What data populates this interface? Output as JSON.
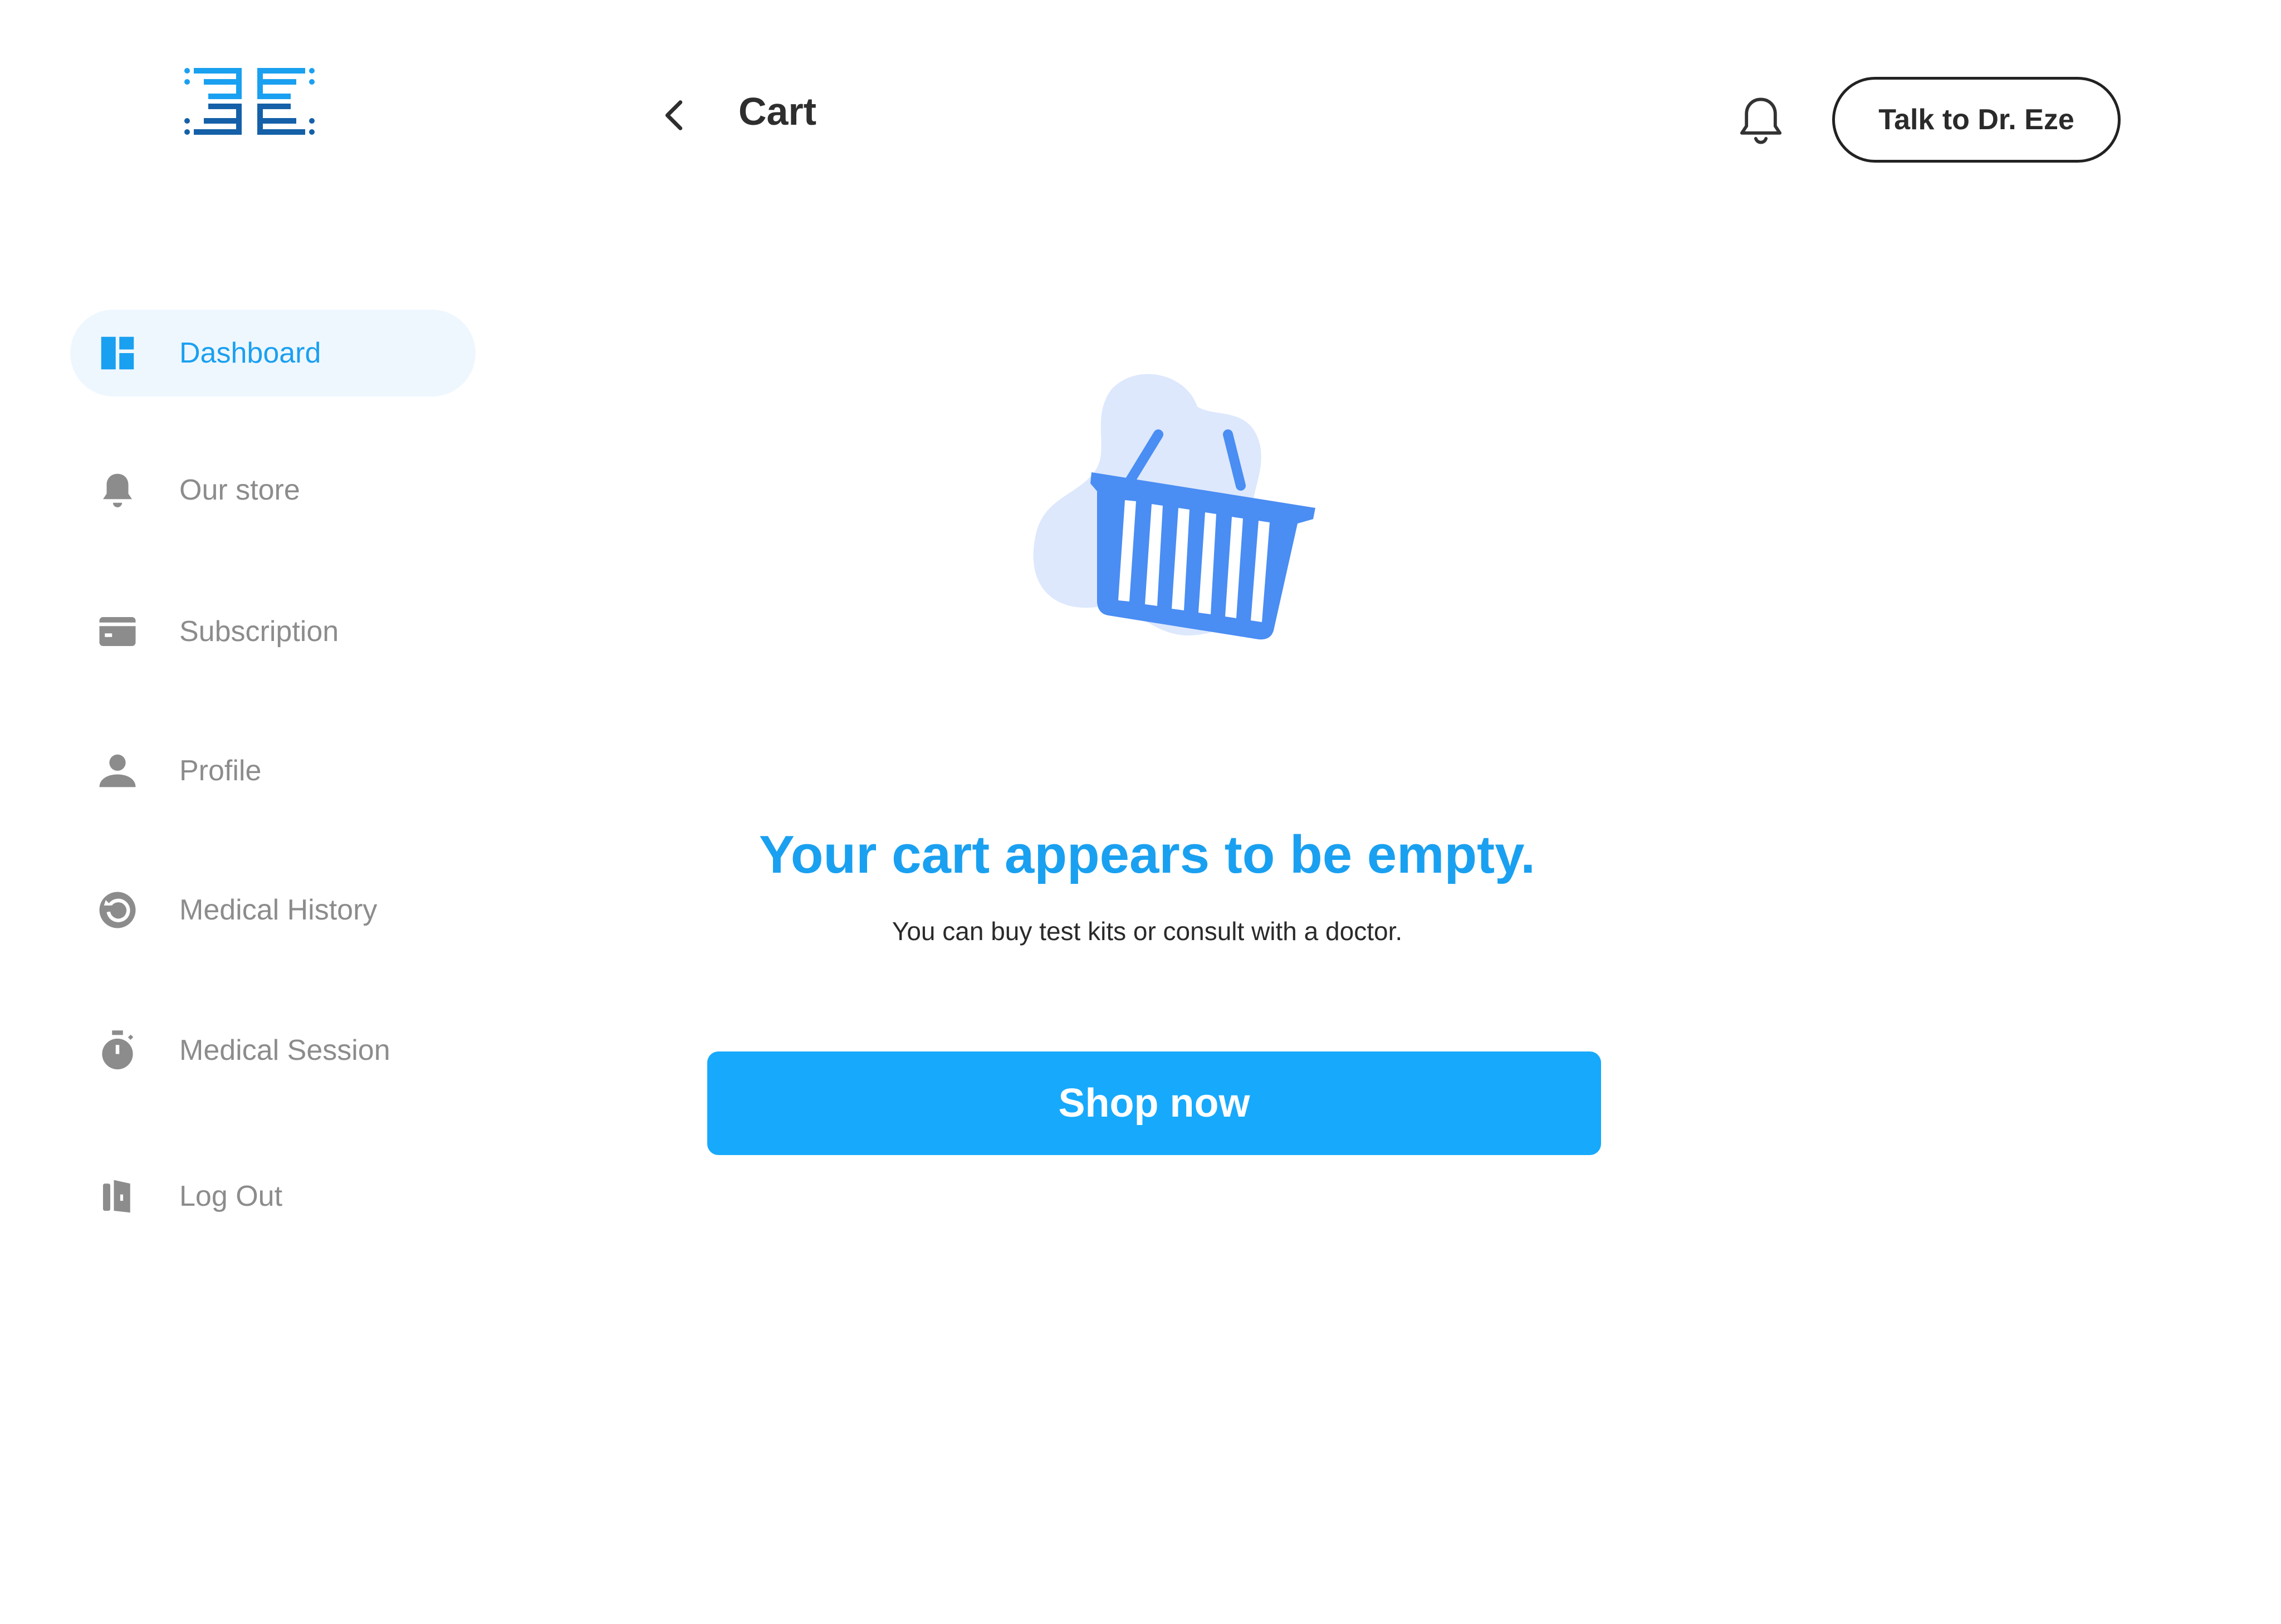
{
  "header": {
    "title": "Cart",
    "talk_button": "Talk to Dr. Eze"
  },
  "sidebar": {
    "items": [
      {
        "label": "Dashboard",
        "icon": "dashboard-icon",
        "active": true
      },
      {
        "label": "Our store",
        "icon": "bell-icon",
        "active": false
      },
      {
        "label": "Subscription",
        "icon": "credit-card-icon",
        "active": false
      },
      {
        "label": "Profile",
        "icon": "person-icon",
        "active": false
      },
      {
        "label": "Medical History",
        "icon": "history-icon",
        "active": false
      },
      {
        "label": "Medical Session",
        "icon": "stopwatch-icon",
        "active": false
      },
      {
        "label": "Log Out",
        "icon": "logout-icon",
        "active": false
      }
    ]
  },
  "main": {
    "empty_title": "Your cart appears to be empty.",
    "empty_subtitle": "You can buy test kits or consult with a doctor.",
    "shop_button": "Shop now"
  },
  "colors": {
    "accent": "#1aa0f0",
    "button": "#17a9fc",
    "active_nav_bg": "#eff7fe",
    "nav_inactive": "#8c8c8c",
    "illustration_blob": "#dde8fd",
    "basket": "#4a8df3"
  }
}
